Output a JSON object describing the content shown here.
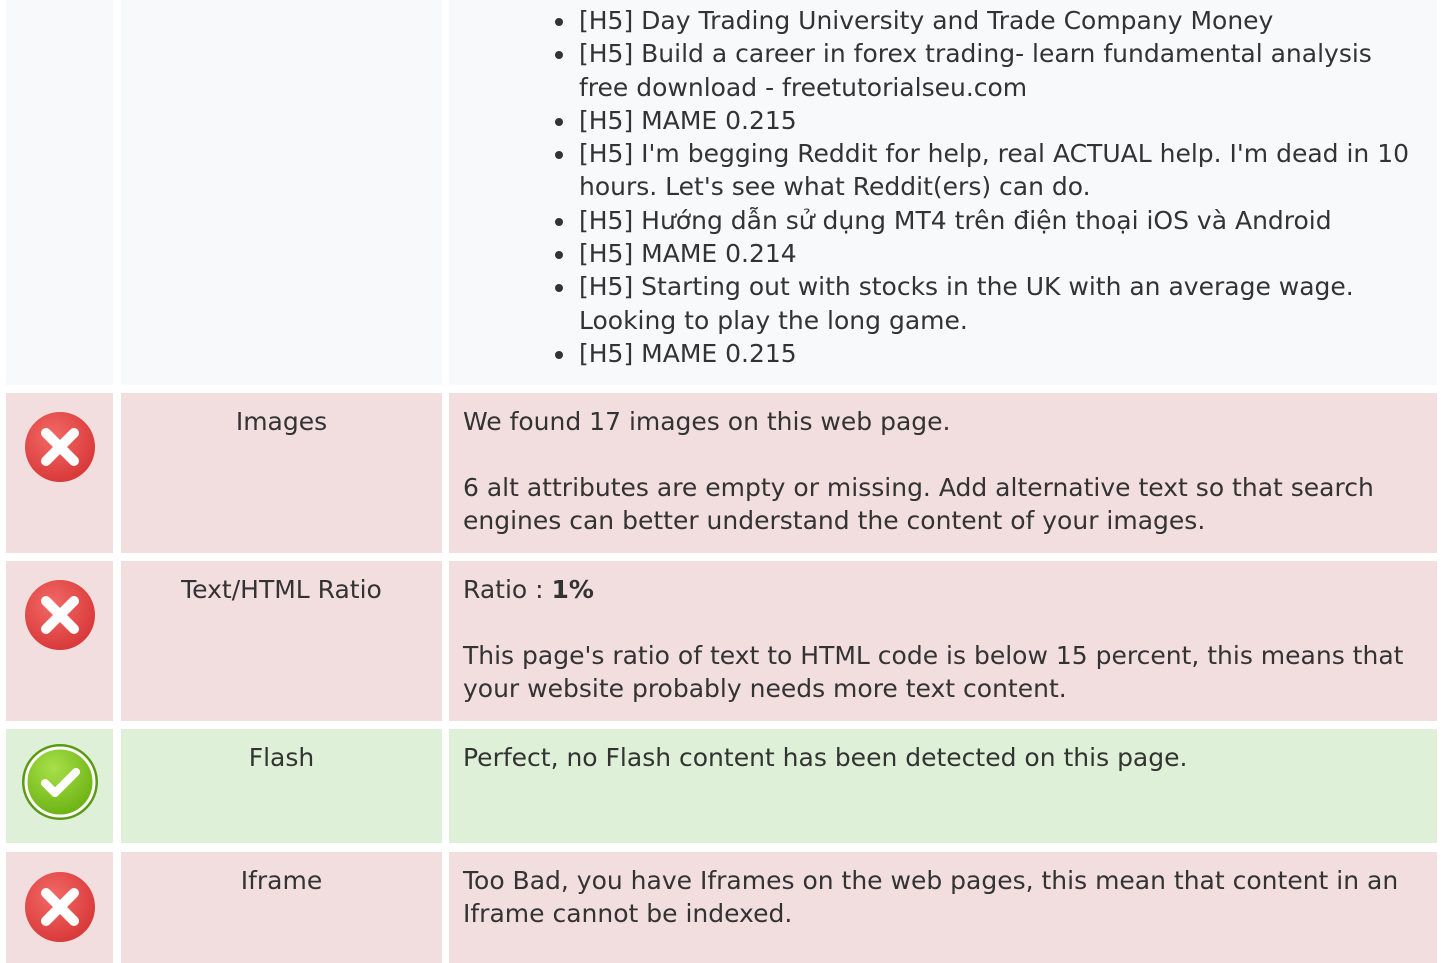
{
  "headings_row": {
    "items": [
      "[H5] Day Trading University and Trade Company Money",
      "[H5] Build a career in forex trading- learn fundamental analysis free download - freetutorialseu.com",
      "[H5] MAME 0.215",
      "[H5] I'm begging Reddit for help, real ACTUAL help. I'm dead in 10 hours. Let's see what Reddit(ers) can do.",
      "[H5] Hướng dẫn sử dụng MT4 trên điện thoại iOS và Android",
      "[H5] MAME 0.214",
      "[H5] Starting out with stocks in the UK with an average wage. Looking to play the long game.",
      "[H5] MAME 0.215"
    ]
  },
  "images": {
    "status": "fail",
    "label": "Images",
    "line1": "We found 17 images on this web page.",
    "line2": "6 alt attributes are empty or missing. Add alternative text so that search engines can better understand the content of your images."
  },
  "ratio": {
    "status": "fail",
    "label": "Text/HTML Ratio",
    "prefix": "Ratio : ",
    "value": "1%",
    "line2": "This page's ratio of text to HTML code is below 15 percent, this means that your website probably needs more text content."
  },
  "flash": {
    "status": "pass",
    "label": "Flash",
    "line1": "Perfect, no Flash content has been detected on this page."
  },
  "iframe": {
    "status": "fail",
    "label": "Iframe",
    "line1": "Too Bad, you have Iframes on the web pages, this mean that content in an Iframe cannot be indexed."
  },
  "icons": {
    "fail": "error-x-icon",
    "pass": "check-icon"
  },
  "colors": {
    "fail_bg": "#f2dede",
    "pass_bg": "#dff0d8",
    "neutral_bg": "#f8f9fa",
    "fail_icon": "#e0403f",
    "pass_icon": "#7cc21e"
  }
}
